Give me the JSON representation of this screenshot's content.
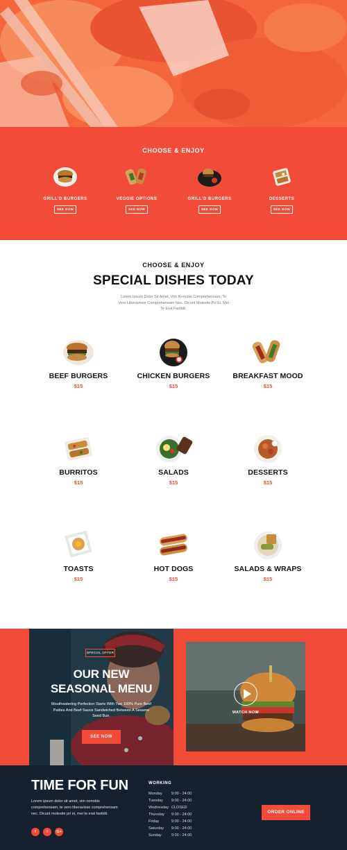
{
  "categories": {
    "kicker": "CHOOSE & ENJOY",
    "items": [
      {
        "label": "GRILL'D BURGERS",
        "button": "SEE NOW"
      },
      {
        "label": "VEGGIE OPTIONS",
        "button": "SEE NOW"
      },
      {
        "label": "GRILL'D BURGERS",
        "button": "SEE NOW"
      },
      {
        "label": "DESSERTS",
        "button": "SEE NOW"
      }
    ]
  },
  "special": {
    "kicker": "CHOOSE & ENJOY",
    "title": "SPECIAL DISHES TODAY",
    "description": "Lorem Ipsum Dolor Sit Amet, Vim Nonobis Comprehensam, Te Vero Liberavisse Comprehensam Nec. Dicunt Molestie Pri Ei, Mei Te Erat Fastidii.",
    "dishes": [
      {
        "name": "BEEF BURGERS",
        "price": "$15"
      },
      {
        "name": "CHICKEN BURGERS",
        "price": "$15"
      },
      {
        "name": "BREAKFAST MOOD",
        "price": "$15"
      },
      {
        "name": "BURRITOS",
        "price": "$15"
      },
      {
        "name": "SALADS",
        "price": "$15"
      },
      {
        "name": "DESSERTS",
        "price": "$15"
      },
      {
        "name": "TOASTS",
        "price": "$15"
      },
      {
        "name": "HOT DOGS",
        "price": "$15"
      },
      {
        "name": "SALADS & WRAPS",
        "price": "$15"
      }
    ]
  },
  "promo": {
    "badge": "SPECIAL OFFER",
    "headline_line1": "OUR NEW",
    "headline_line2": "SEASONAL MENU",
    "copy": "Mouthwatering Perfection Starts With Two 100% Pure Beef Patties And Beef Sauce Sandwiched Between A Sesame Seed Bun.",
    "cta": "SEE NOW",
    "video_label": "WATCH NOW"
  },
  "footer": {
    "title": "TIME FOR FUN",
    "text": "Lorem ipsum dolor sit amet, vim nonobis comprehensam, te vero liberavisse comprehensam nec. Dicunt molestie pri ei, mei te erat fastidii.",
    "social": {
      "facebook": "f",
      "twitter": "t",
      "google": "G+"
    },
    "hours_title": "WORKING",
    "hours": [
      {
        "day": "Monday",
        "time": "9:00 - 24:00"
      },
      {
        "day": "Tuesday",
        "time": "9:00 - 24:00"
      },
      {
        "day": "Wednesday",
        "time": "CLOSED"
      },
      {
        "day": "Thursday",
        "time": "9:00 - 24:00"
      },
      {
        "day": "Friday",
        "time": "9:00 - 24:00"
      },
      {
        "day": "Saturday",
        "time": "9:00 - 24:00"
      },
      {
        "day": "Sunday",
        "time": "9:00 - 24:00"
      }
    ],
    "order_button": "ORDER ONLINE"
  },
  "colors": {
    "accent": "#f24b37",
    "footer_bg": "#17202e",
    "price": "#e64a33"
  }
}
